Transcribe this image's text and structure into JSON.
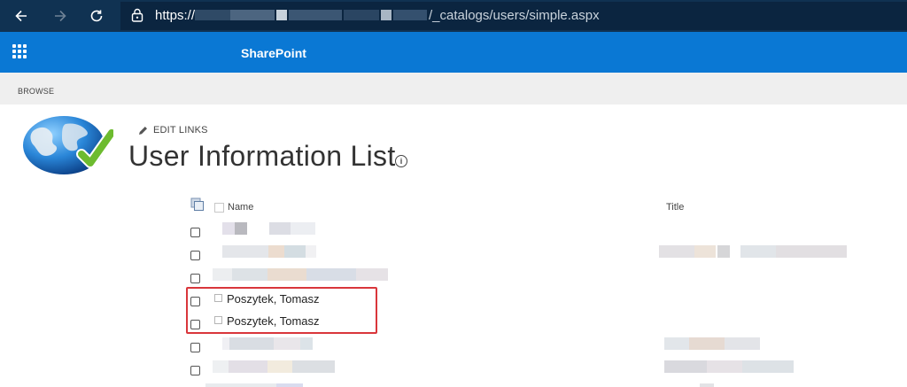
{
  "browser": {
    "url_prefix": "https://",
    "url_suffix": "/_catalogs/users/simple.aspx",
    "back_icon": "arrow-left-icon",
    "forward_icon": "arrow-right-icon",
    "refresh_icon": "refresh-icon",
    "lock_icon": "lock-icon"
  },
  "suite_bar": {
    "app_launcher_icon": "waffle-icon",
    "app_name": "SharePoint",
    "color": "#0a78d4"
  },
  "ribbon": {
    "tab": "BROWSE"
  },
  "page": {
    "edit_links": "EDIT LINKS",
    "title": "User Information List",
    "info_icon": "i"
  },
  "list": {
    "columns": {
      "name": "Name",
      "title": "Title"
    },
    "visible_names": [
      "Poszytek, Tomasz",
      "Poszytek, Tomasz"
    ],
    "highlight_color": "#d9363b"
  }
}
